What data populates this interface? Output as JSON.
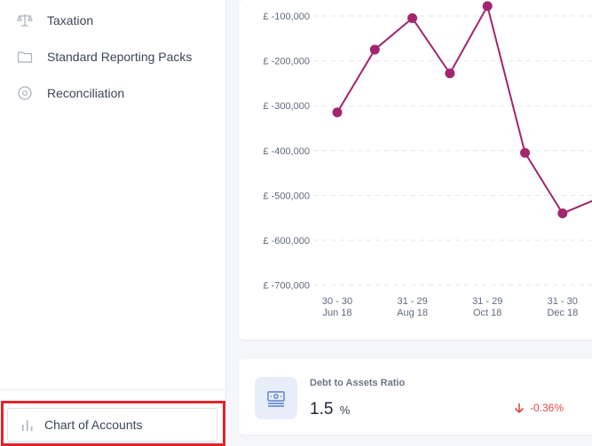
{
  "sidebar": {
    "items": [
      {
        "label": "Taxation",
        "icon": "scales-icon"
      },
      {
        "label": "Standard Reporting Packs",
        "icon": "folder-icon"
      },
      {
        "label": "Reconciliation",
        "icon": "target-icon"
      }
    ],
    "chart_of_accounts_label": "Chart of Accounts"
  },
  "chart_data": {
    "type": "line",
    "y_tick_labels": [
      "£ -100,000",
      "£ -200,000",
      "£ -300,000",
      "£ -400,000",
      "£ -500,000",
      "£ -600,000",
      "£ -700,000"
    ],
    "x_tick_labels": [
      {
        "line1": "30 - 30",
        "line2": "Jun 18"
      },
      {
        "line1": "31 - 29",
        "line2": "Aug 18"
      },
      {
        "line1": "31 - 29",
        "line2": "Oct 18"
      },
      {
        "line1": "31 - 30",
        "line2": "Dec 18"
      }
    ],
    "ylim": [
      -700000,
      -100000
    ],
    "grid": true,
    "series": [
      {
        "color": "#a3256e",
        "values": [
          -315000,
          -175000,
          -105000,
          -228000,
          -78000,
          -405000,
          -540000,
          -505000
        ]
      }
    ]
  },
  "ratio_card": {
    "title": "Debt to Assets Ratio",
    "value": "1.5",
    "unit": "%",
    "change": "-0.36%",
    "change_color": "#e04848",
    "icon": "cash-icon"
  }
}
